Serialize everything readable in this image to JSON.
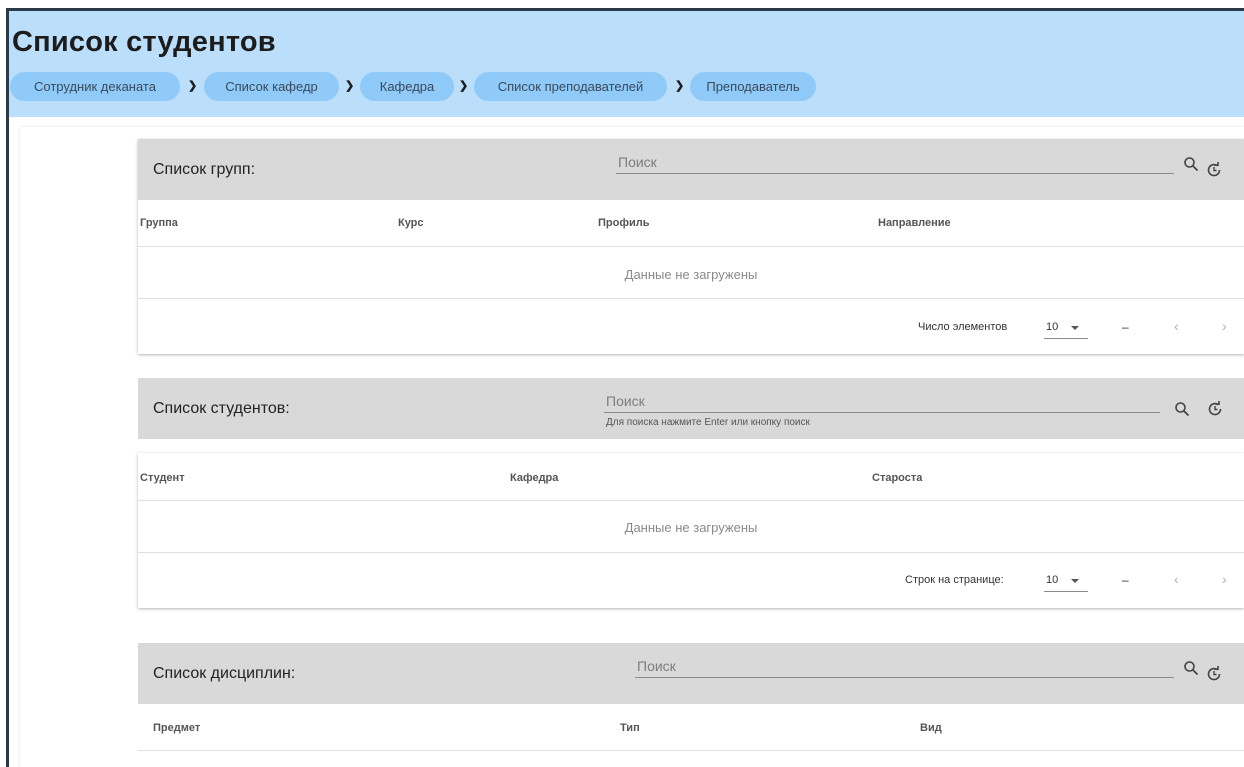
{
  "page": {
    "title": "Список студентов"
  },
  "breadcrumbs": [
    "Сотрудник деканата",
    "Список кафедр",
    "Кафедра",
    "Список преподавателей",
    "Преподаватель"
  ],
  "breadcrumb_separator": "❯",
  "groups": {
    "title": "Список групп:",
    "search_placeholder": "Поиск",
    "columns": [
      "Группа",
      "Курс",
      "Профиль",
      "Направление"
    ],
    "empty_message": "Данные не загружены",
    "pagination": {
      "label": "Число элементов",
      "page_size": "10",
      "range": "–",
      "prev": "‹",
      "next": "›"
    }
  },
  "students": {
    "title": "Список студентов:",
    "search_placeholder": "Поиск",
    "search_hint": "Для поиска нажмите Enter или кнопку поиск",
    "columns": [
      "Студент",
      "Кафедра",
      "Староста"
    ],
    "empty_message": "Данные не загружены",
    "pagination": {
      "label": "Строк на странице:",
      "page_size": "10",
      "range": "–",
      "prev": "‹",
      "next": "›"
    }
  },
  "disciplines": {
    "title": "Список дисциплин:",
    "search_placeholder": "Поиск",
    "columns": [
      "Предмет",
      "Тип",
      "Вид"
    ]
  },
  "icons": {
    "search": "search-icon",
    "refresh": "refresh-icon"
  },
  "colors": {
    "header_bg": "#bbdefb",
    "breadcrumb_bg": "#90caf9",
    "toolbar_bg": "#d9d9d9"
  }
}
